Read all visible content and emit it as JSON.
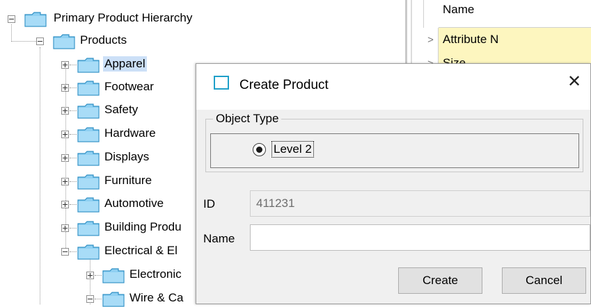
{
  "tree": {
    "root": {
      "label": "Primary Product Hierarchy"
    },
    "products": {
      "label": "Products"
    },
    "categories": [
      {
        "label": "Apparel",
        "selected": true
      },
      {
        "label": "Footwear"
      },
      {
        "label": "Safety"
      },
      {
        "label": "Hardware"
      },
      {
        "label": "Displays"
      },
      {
        "label": "Furniture"
      },
      {
        "label": "Automotive"
      },
      {
        "label": "Building Produ"
      },
      {
        "label": "Electrical & El"
      }
    ],
    "sub_categories": [
      {
        "label": "Electronic"
      },
      {
        "label": "Wire & Ca"
      }
    ]
  },
  "grid": {
    "header": "Name",
    "rows": [
      {
        "arrow": ">",
        "value": "Attribute N"
      },
      {
        "arrow": ">",
        "value": "Size"
      }
    ]
  },
  "dialog": {
    "title": "Create Product",
    "close_glyph": "✕",
    "object_type": {
      "legend": "Object Type",
      "selected_option": "Level 2"
    },
    "id_field": {
      "label": "ID",
      "value": "411231"
    },
    "name_field": {
      "label": "Name",
      "value": ""
    },
    "create_label": "Create",
    "cancel_label": "Cancel"
  },
  "colors": {
    "selection": "#cce0f7",
    "grid_cell": "#fdf6bf",
    "folder_fill": "#8fd0f2",
    "icon_accent": "#1fa0c9"
  }
}
